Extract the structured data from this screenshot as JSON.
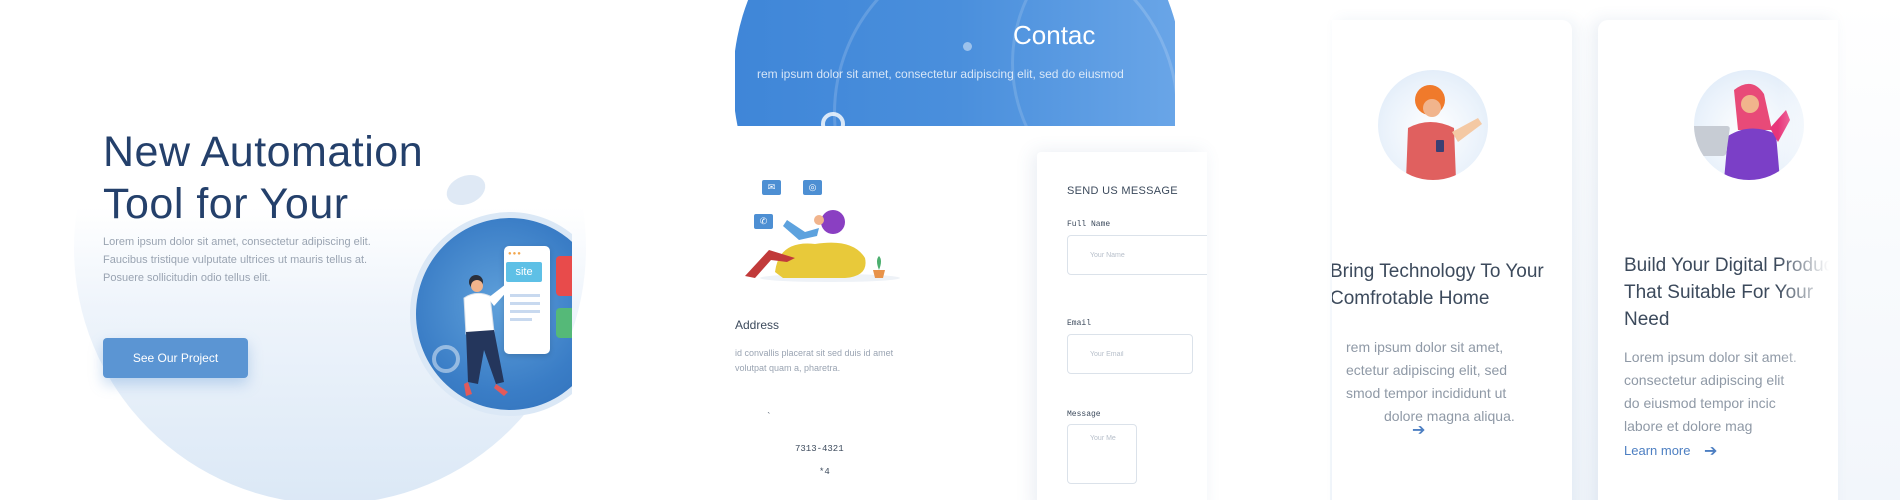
{
  "hero": {
    "title_line1": "New Automation",
    "title_line2": "Tool for Your",
    "description": "Lorem ipsum dolor sit amet, consectetur adipiscing elit. Faucibus tristique vulputate ultrices ut mauris tellus at. Posuere sollicitudin odio tellus elit.",
    "cta_label": "See Our Project",
    "illustration_tag": "site",
    "colors": {
      "title": "#24406b",
      "button": "#5b95d3"
    }
  },
  "contact": {
    "title": "Contac",
    "subtitle": "rem ipsum dolor sit amet, consectetur adipiscing elit, sed do eiusmod",
    "address_heading": "Address",
    "address_text": "id convallis placerat sit sed duis id amet volutpat quam a, pharetra.",
    "phone_partial": "7313-4321",
    "phone_partial_2": "*4",
    "mark": "`",
    "form": {
      "heading": "SEND US MESSAGE",
      "full_name_label": "Full Name",
      "full_name_placeholder": "Your Name",
      "email_label": "Email",
      "email_placeholder": "Your Email",
      "message_label": "Message",
      "message_placeholder": "Your Me"
    },
    "colors": {
      "accent": "#3f86d8"
    }
  },
  "cards": [
    {
      "title_lines": [
        "Bring Technology To Your",
        "Comfrotable Home"
      ],
      "text_lines": [
        "rem ipsum dolor sit amet,",
        "ectetur adipiscing elit, sed",
        "smod tempor incididunt ut",
        "dolore magna aliqua."
      ],
      "link_label": "",
      "avatar": "person-with-phone-illustration"
    },
    {
      "title_lines": [
        "Build Your Digital Product",
        "That Suitable For Your",
        "Need"
      ],
      "text_lines": [
        "Lorem ipsum dolor sit amet.",
        "consectetur adipiscing elit",
        "do eiusmod tempor incic",
        "labore et dolore mag"
      ],
      "link_label": "Learn more",
      "avatar": "person-with-laptop-illustration"
    }
  ]
}
